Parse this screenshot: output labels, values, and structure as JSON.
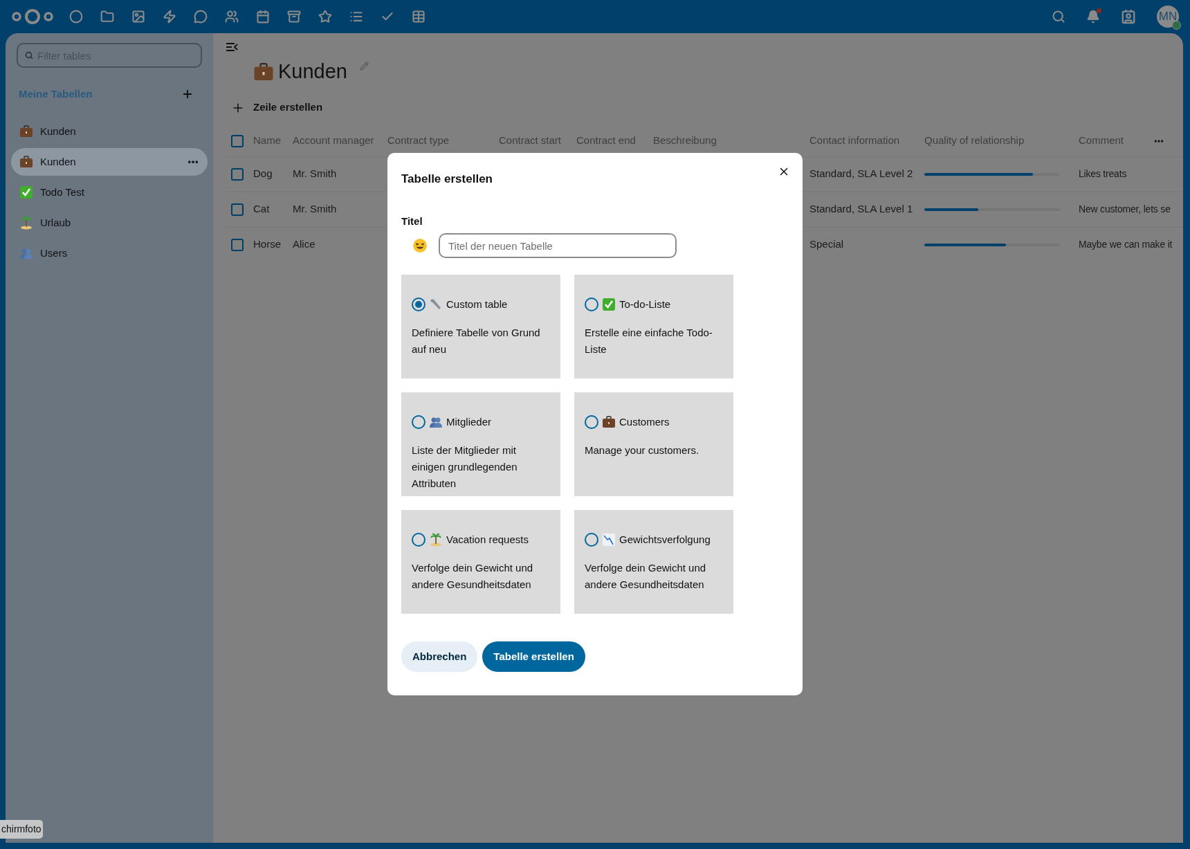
{
  "header": {
    "avatar": "MN"
  },
  "sidebar": {
    "filter_placeholder": "Filter tables",
    "section": "Meine Tabellen",
    "items": [
      {
        "label": "Kunden",
        "selected": false
      },
      {
        "label": "Kunden",
        "selected": true
      },
      {
        "label": "Todo Test",
        "selected": false
      },
      {
        "label": "Urlaub",
        "selected": false
      },
      {
        "label": "Users",
        "selected": false
      }
    ]
  },
  "main": {
    "title": "Kunden",
    "add_row": "Zeile erstellen",
    "table": {
      "header_checked": false,
      "columns": [
        "Name",
        "Account manager",
        "Contract type",
        "Contract start",
        "Contract end",
        "Beschreibung",
        "Contact information",
        "Quality of relationship",
        "Comment"
      ],
      "rows": [
        {
          "checked": false,
          "name": "Dog",
          "account_manager": "Mr. Smith",
          "contact": "Standard, SLA Level 2",
          "level": 0.8,
          "comment": "Likes treats"
        },
        {
          "checked": false,
          "name": "Cat",
          "account_manager": "Mr. Smith",
          "contact": "Standard, SLA Level 1",
          "level": 0.4,
          "comment": "New customer, lets se"
        },
        {
          "checked": false,
          "name": "Horse",
          "account_manager": "Alice",
          "contact": "Special",
          "level": 0.6,
          "comment": "Maybe we can make it"
        }
      ]
    }
  },
  "dialog": {
    "title": "Tabelle erstellen",
    "title_label": "Titel",
    "placeholder": "Titel der neuen Tabelle",
    "options": [
      {
        "label": "Custom table",
        "description": "Definiere Tabelle von Grund auf neu",
        "selected": true
      },
      {
        "label": "To-do-Liste",
        "description": "Erstelle eine einfache Todo-Liste",
        "selected": false
      },
      {
        "label": "Mitglieder",
        "description": "Liste der Mitglieder mit einigen grundlegenden Attributen",
        "selected": false
      },
      {
        "label": "Customers",
        "description": "Manage your customers.",
        "selected": false
      },
      {
        "label": "Vacation requests",
        "description": "Verfolge dein Gewicht und andere Gesundheitsdaten",
        "selected": false
      },
      {
        "label": "Gewichtsverfolgung",
        "description": "Verfolge dein Gewicht und andere Gesundheitsdaten",
        "selected": false
      }
    ],
    "cancel": "Abbrechen",
    "create": "Tabelle erstellen"
  },
  "tooltip": "chirmfoto"
}
